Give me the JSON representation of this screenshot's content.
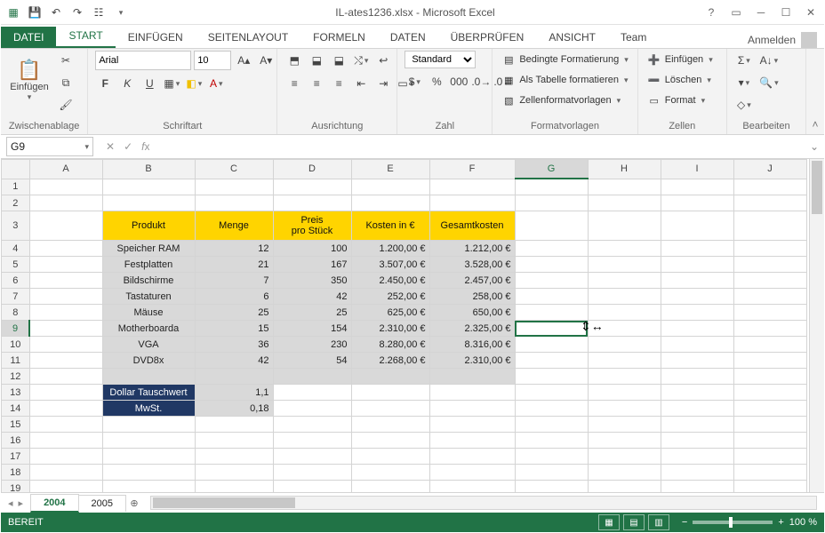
{
  "titlebar": {
    "title": "IL-ates1236.xlsx - Microsoft Excel"
  },
  "tabs": {
    "file": "DATEI",
    "items": [
      "START",
      "EINFÜGEN",
      "SEITENLAYOUT",
      "FORMELN",
      "DATEN",
      "ÜBERPRÜFEN",
      "ANSICHT",
      "Team"
    ],
    "active": 0,
    "signin": "Anmelden"
  },
  "ribbon": {
    "clipboard": {
      "paste": "Einfügen",
      "label": "Zwischenablage"
    },
    "font": {
      "name": "Arial",
      "size": "10",
      "label": "Schriftart"
    },
    "alignment": {
      "label": "Ausrichtung"
    },
    "number": {
      "format": "Standard",
      "label": "Zahl"
    },
    "styles": {
      "cond": "Bedingte Formatierung",
      "table": "Als Tabelle formatieren",
      "cell": "Zellenformatvorlagen",
      "label": "Formatvorlagen"
    },
    "cells": {
      "insert": "Einfügen",
      "delete": "Löschen",
      "format": "Format",
      "label": "Zellen"
    },
    "editing": {
      "label": "Bearbeiten"
    }
  },
  "namebox": "G9",
  "columns": [
    "A",
    "B",
    "C",
    "D",
    "E",
    "F",
    "G",
    "H",
    "I",
    "J"
  ],
  "rows": [
    "1",
    "2",
    "3",
    "4",
    "5",
    "6",
    "7",
    "8",
    "9",
    "10",
    "11",
    "12",
    "13",
    "14",
    "15",
    "16",
    "17",
    "18",
    "19"
  ],
  "selected": {
    "col": "G",
    "row": "9"
  },
  "header": {
    "produkt": "Produkt",
    "menge": "Menge",
    "preis1": "Preis",
    "preis2": "pro Stück",
    "kosten": "Kosten in €",
    "gesamt": "Gesamtkosten"
  },
  "data": [
    {
      "produkt": "Speicher RAM",
      "menge": "12",
      "preis": "100",
      "kosten": "1.200,00 €",
      "gesamt": "1.212,00 €"
    },
    {
      "produkt": "Festplatten",
      "menge": "21",
      "preis": "167",
      "kosten": "3.507,00 €",
      "gesamt": "3.528,00 €"
    },
    {
      "produkt": "Bildschirme",
      "menge": "7",
      "preis": "350",
      "kosten": "2.450,00 €",
      "gesamt": "2.457,00 €"
    },
    {
      "produkt": "Tastaturen",
      "menge": "6",
      "preis": "42",
      "kosten": "252,00 €",
      "gesamt": "258,00 €"
    },
    {
      "produkt": "Mäuse",
      "menge": "25",
      "preis": "25",
      "kosten": "625,00 €",
      "gesamt": "650,00 €"
    },
    {
      "produkt": "Motherboarda",
      "menge": "15",
      "preis": "154",
      "kosten": "2.310,00 €",
      "gesamt": "2.325,00 €"
    },
    {
      "produkt": "VGA",
      "menge": "36",
      "preis": "230",
      "kosten": "8.280,00 €",
      "gesamt": "8.316,00 €"
    },
    {
      "produkt": "DVD8x",
      "menge": "42",
      "preis": "54",
      "kosten": "2.268,00 €",
      "gesamt": "2.310,00 €"
    }
  ],
  "footer": {
    "dollar_label": "Dollar Tauschwert",
    "dollar_val": "1,1",
    "mwst_label": "MwSt.",
    "mwst_val": "0,18"
  },
  "sheets": {
    "active": "2004",
    "other": "2005"
  },
  "status": {
    "ready": "BEREIT",
    "zoom": "100 %"
  }
}
